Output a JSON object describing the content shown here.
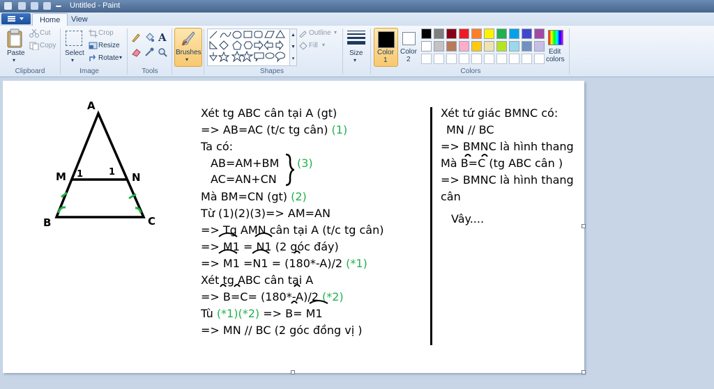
{
  "window": {
    "title": "Untitled - Paint"
  },
  "tabs": [
    {
      "label": "Home"
    },
    {
      "label": "View"
    }
  ],
  "ribbon": {
    "clipboard": {
      "paste": "Paste",
      "cut": "Cut",
      "copy": "Copy",
      "group": "Clipboard"
    },
    "image": {
      "select": "Select",
      "crop": "Crop",
      "resize": "Resize",
      "rotate": "Rotate",
      "group": "Image"
    },
    "tools": {
      "group": "Tools"
    },
    "brushes": {
      "label": "Brushes"
    },
    "shapes": {
      "outline": "Outline",
      "fill": "Fill",
      "group": "Shapes"
    },
    "size": {
      "label": "Size"
    },
    "color1": {
      "label": "Color",
      "num": "1"
    },
    "color2": {
      "label": "Color",
      "num": "2"
    },
    "colors": {
      "group": "Colors",
      "edit_line1": "Edit",
      "edit_line2": "colors"
    },
    "palette_row1": [
      "#000000",
      "#7f7f7f",
      "#880015",
      "#ed1c24",
      "#ff7f27",
      "#fff200",
      "#22b14c",
      "#00a2e8",
      "#3f48cc",
      "#a349a4"
    ],
    "palette_row2": [
      "#ffffff",
      "#c3c3c3",
      "#b97a57",
      "#ffaec9",
      "#ffc90e",
      "#efe4b0",
      "#b5e61d",
      "#99d9ea",
      "#7092be",
      "#c8bfe7"
    ]
  },
  "drawing": {
    "labels": {
      "a": "A",
      "m": "M",
      "n": "N",
      "b": "B",
      "c": "C",
      "one_m": "1",
      "one_n": "1"
    },
    "proof_lines": [
      {
        "text": "Xét tg ABC cân tại A (gt)"
      },
      {
        "text": "=> AB=AC (t/c tg cân)",
        "green": "(1)"
      },
      {
        "text": "Ta có:"
      },
      {
        "text": "AB=AM+BM"
      },
      {
        "text": "AC=AN+CN"
      },
      {
        "text": "Mà BM=CN (gt)",
        "green": "(2)"
      },
      {
        "text": "Từ (1)(2)(3)=> AM=AN"
      },
      {
        "text": "=> Tg AMN cân tại A (t/c tg cân)"
      },
      {
        "text": "=> M1 = N1 (2 góc đáy)"
      },
      {
        "text": "=> M1 =N1 = (180*-A)/2",
        "green": "(*1)"
      },
      {
        "text": "Xét tg ABC cân tại A"
      },
      {
        "text": "=> B=C= (180*-A)/2",
        "green": "(*2)"
      },
      {
        "text": "Tù",
        "green": "(*1)(*2)",
        "after": "=> B= M1"
      },
      {
        "text": "=> MN // BC (2 góc đồng vị )"
      }
    ],
    "brace_label": "(3)",
    "right_lines": [
      "Xét tứ giác BMNC có:",
      "MN // BC",
      "=> BMNC là hình thang",
      "Mà B=C (tg ABC cân )",
      "=> BMNC là hình thang",
      "cân",
      "Vây...."
    ]
  }
}
